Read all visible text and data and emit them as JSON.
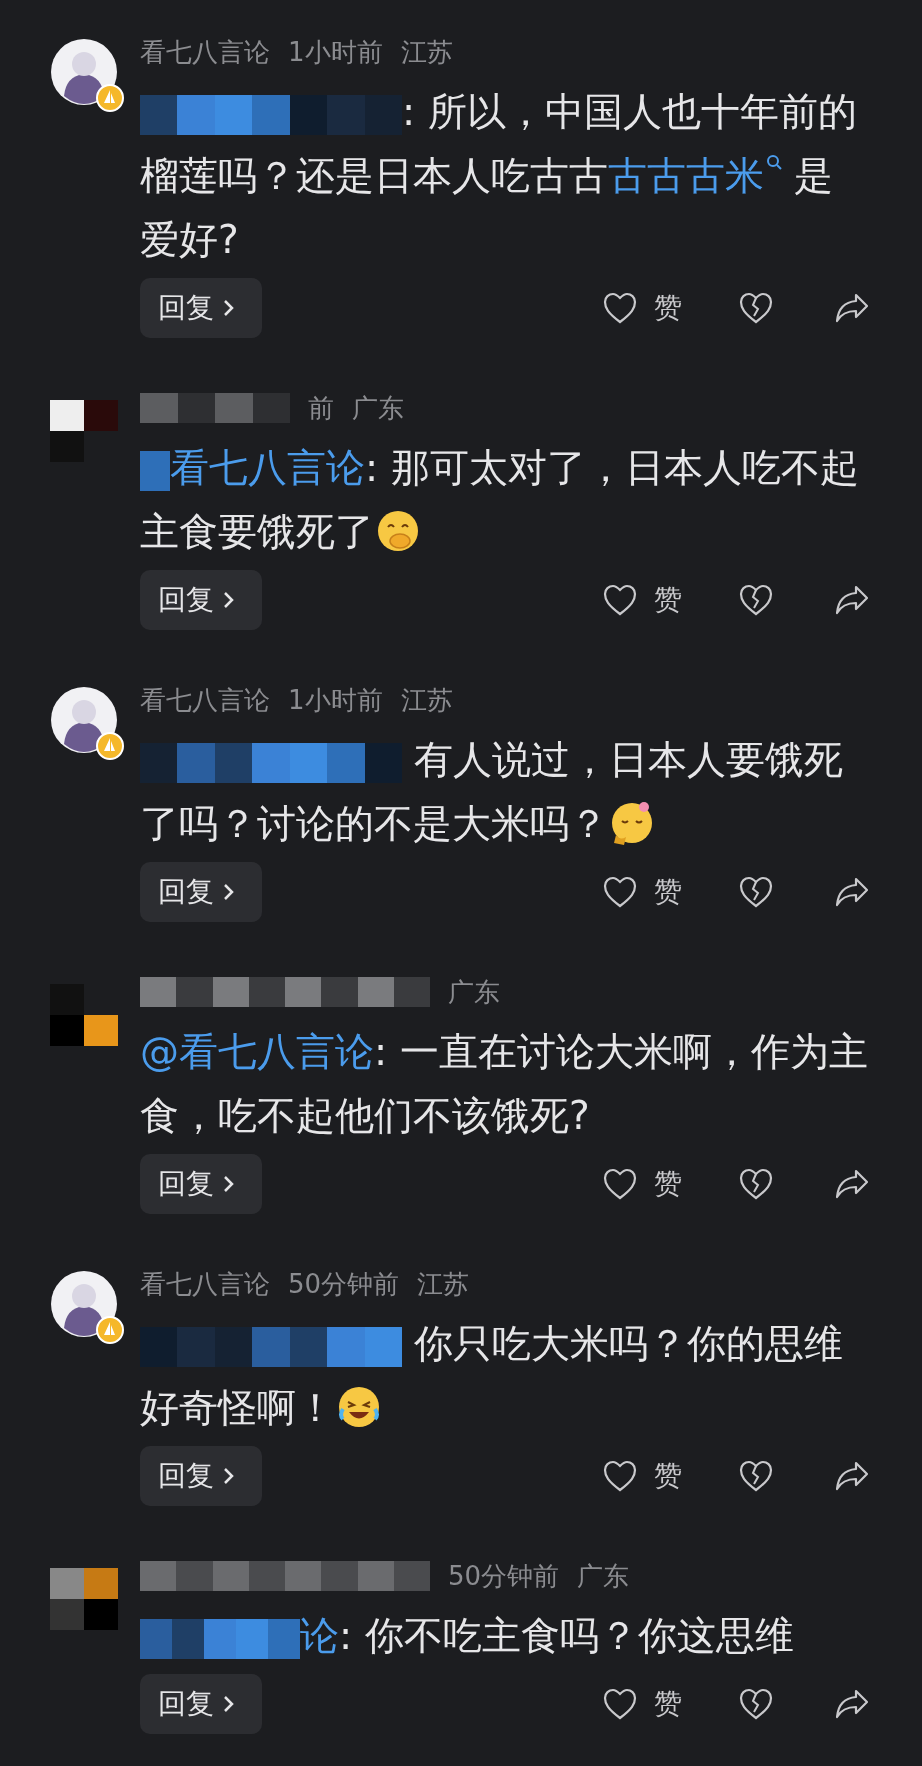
{
  "comments": [
    {
      "avatar": {
        "kind": "cartoon",
        "badge": true
      },
      "author": "看七八言论",
      "time": "1小时前",
      "location": "江苏",
      "redaction": {
        "kind": "full"
      },
      "body": [
        {
          "kind": "plain",
          "text": ": 所以，中国人也十年前的榴莲吗？还是日本人吃古古"
        },
        {
          "kind": "link",
          "text": "古古古米"
        },
        {
          "kind": "plain",
          "text": " 是爱好?"
        }
      ],
      "reply": "回复",
      "like": "赞"
    },
    {
      "avatar": {
        "kind": "mosaic",
        "badge": false
      },
      "name_redacted": true,
      "time": "前",
      "location": "广东",
      "redaction": {
        "kind": "prefix"
      },
      "body": [
        {
          "kind": "mention",
          "text": "看七八言论"
        },
        {
          "kind": "plain",
          "text": ": 那可太对了，日本人吃不起主食要饿死了"
        }
      ],
      "emoji": {
        "kind": "cover-mouth"
      },
      "reply": "回复",
      "like": "赞"
    },
    {
      "avatar": {
        "kind": "cartoon",
        "badge": true
      },
      "author": "看七八言论",
      "time": "1小时前",
      "location": "江苏",
      "redaction": {
        "kind": "full"
      },
      "body": [
        {
          "kind": "plain",
          "text": " 有人说过，日本人要饿死了吗？讨论的不是大米吗？"
        }
      ],
      "emoji": {
        "kind": "blush"
      },
      "reply": "回复",
      "like": "赞"
    },
    {
      "avatar": {
        "kind": "mosaic",
        "badge": false
      },
      "name_redacted": true,
      "location": "广东",
      "body": [
        {
          "kind": "mention",
          "text": "@看七八言论"
        },
        {
          "kind": "plain",
          "text": ": 一直在讨论大米啊，作为主食，吃不起他们不该饿死?"
        }
      ],
      "reply": "回复",
      "like": "赞"
    },
    {
      "avatar": {
        "kind": "cartoon",
        "badge": true
      },
      "author": "看七八言论",
      "time": "50分钟前",
      "location": "江苏",
      "redaction": {
        "kind": "full"
      },
      "body": [
        {
          "kind": "plain",
          "text": " 你只吃大米吗？你的思维好奇怪啊！"
        }
      ],
      "emoji": {
        "kind": "laugh"
      },
      "reply": "回复",
      "like": "赞"
    },
    {
      "avatar": {
        "kind": "mosaic",
        "badge": false
      },
      "name_redacted": true,
      "time": "50分钟前",
      "location": "广东",
      "redaction": {
        "kind": "partial"
      },
      "body": [
        {
          "kind": "mention",
          "text": "论"
        },
        {
          "kind": "plain",
          "text": ": 你不吃主食吗？你这思维"
        }
      ],
      "reply": "回复",
      "like": "赞"
    }
  ]
}
